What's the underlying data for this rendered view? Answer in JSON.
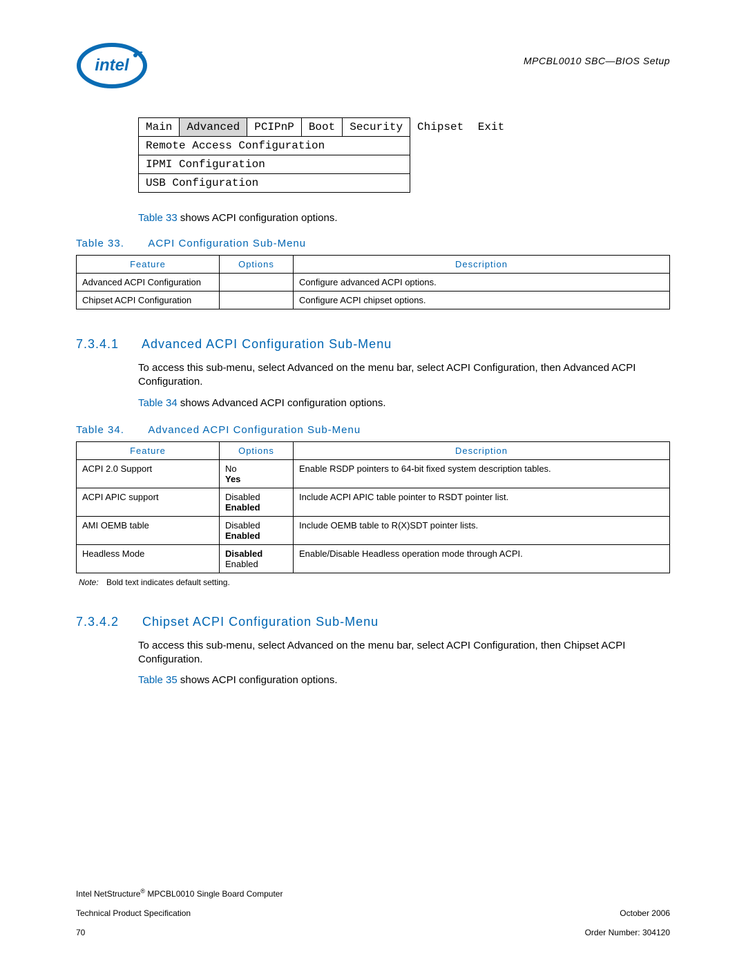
{
  "header": {
    "right_text": "MPCBL0010 SBC—BIOS Setup"
  },
  "menu": {
    "tabs": [
      "Main",
      "Advanced",
      "PCIPnP",
      "Boot",
      "Security",
      "Chipset",
      "Exit"
    ],
    "selected_index": 1,
    "sub_items": [
      "Remote Access Configuration",
      "IPMI Configuration",
      "USB Configuration"
    ]
  },
  "intro_line": {
    "link": "Table 33",
    "rest": " shows ACPI configuration options."
  },
  "table33": {
    "caption_num": "Table 33.",
    "caption_title": "ACPI Configuration Sub-Menu",
    "headers": [
      "Feature",
      "Options",
      "Description"
    ],
    "rows": [
      {
        "feature": "Advanced ACPI Configuration",
        "options": "",
        "description": "Configure advanced ACPI options."
      },
      {
        "feature": "Chipset ACPI Configuration",
        "options": "",
        "description": "Configure ACPI chipset options."
      }
    ]
  },
  "section1": {
    "num": "7.3.4.1",
    "title": "Advanced ACPI Configuration Sub-Menu",
    "para": "To access this sub-menu, select Advanced on the menu bar, select ACPI Configuration, then Advanced ACPI Configuration.",
    "line2_link": "Table 34",
    "line2_rest": " shows Advanced ACPI configuration options."
  },
  "table34": {
    "caption_num": "Table 34.",
    "caption_title": "Advanced ACPI Configuration Sub-Menu",
    "headers": [
      "Feature",
      "Options",
      "Description"
    ],
    "rows": [
      {
        "feature": "ACPI 2.0 Support",
        "opt_plain": "No",
        "opt_def": "Yes",
        "description": "Enable RSDP pointers to 64-bit fixed system description tables."
      },
      {
        "feature": "ACPI APIC support",
        "opt_plain": "Disabled",
        "opt_def": "Enabled",
        "description": "Include ACPI APIC table pointer to RSDT pointer list."
      },
      {
        "feature": "AMI OEMB table",
        "opt_plain": "Disabled",
        "opt_def": "Enabled",
        "description": "Include OEMB table to R(X)SDT pointer lists."
      },
      {
        "feature": "Headless Mode",
        "opt_def": "Disabled",
        "opt_plain": "Enabled",
        "description": "Enable/Disable Headless operation mode through ACPI."
      }
    ],
    "note_label": "Note:",
    "note_text": "Bold text indicates default setting."
  },
  "section2": {
    "num": "7.3.4.2",
    "title": "Chipset ACPI Configuration Sub-Menu",
    "para": "To access this sub-menu, select Advanced on the menu bar, select ACPI Configuration, then Chipset ACPI Configuration.",
    "line2_link": "Table 35",
    "line2_rest": " shows ACPI configuration options."
  },
  "footer": {
    "left_line1_a": "Intel NetStructure",
    "left_line1_b": " MPCBL0010 Single Board Computer",
    "left_line2": "Technical Product Specification",
    "left_line3": "70",
    "right_line1": "October 2006",
    "right_line2": "Order Number: 304120"
  }
}
